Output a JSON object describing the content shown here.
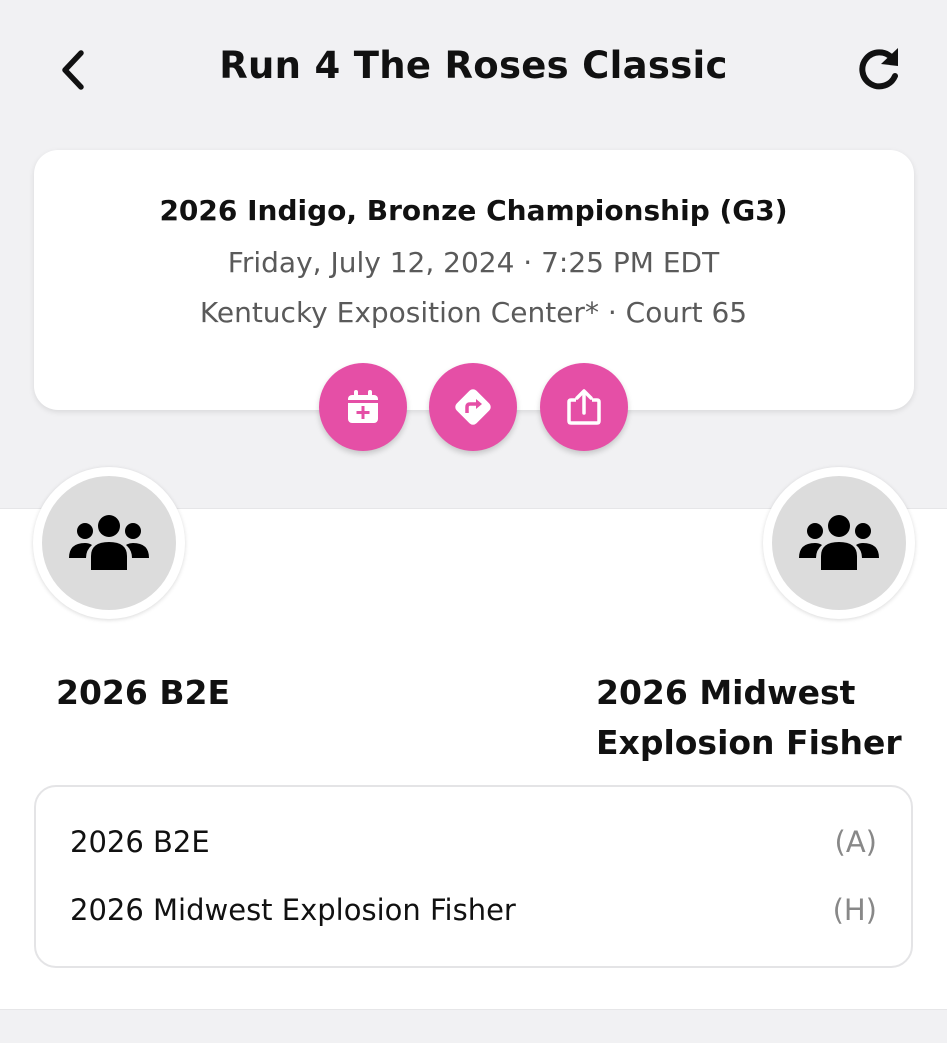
{
  "header": {
    "title": "Run 4 The Roses Classic",
    "back_icon": "chevron-left-icon",
    "refresh_icon": "refresh-icon"
  },
  "event": {
    "name": "2026 Indigo, Bronze Championship (G3)",
    "datetime": "Friday, July 12, 2024 · 7:25 PM EDT",
    "venue": "Kentucky Exposition Center* · Court 65"
  },
  "actions": [
    {
      "icon": "calendar-add-icon"
    },
    {
      "icon": "directions-icon"
    },
    {
      "icon": "share-icon"
    }
  ],
  "accent_color": "#e54fa6",
  "matchup": {
    "left_team": "2026 B2E",
    "right_team": "2026 Midwest Explosion Fisher"
  },
  "teams_list": [
    {
      "name": "2026 B2E",
      "tag": "(A)"
    },
    {
      "name": "2026 Midwest Explosion Fisher",
      "tag": "(H)"
    }
  ]
}
